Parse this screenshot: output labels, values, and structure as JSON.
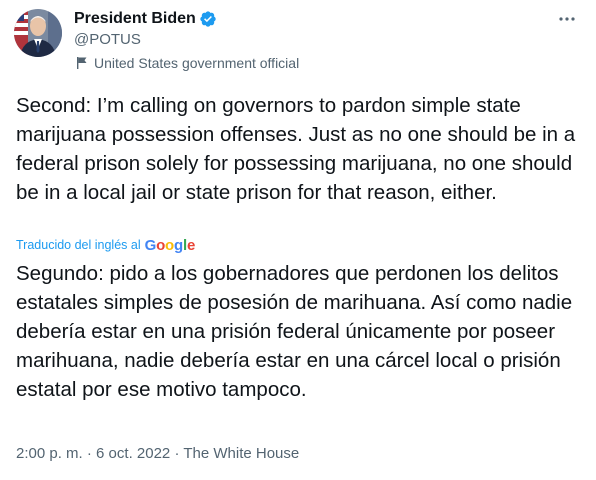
{
  "author": {
    "display_name": "President Biden",
    "handle": "@POTUS",
    "label": "United States government official"
  },
  "tweet": {
    "text": "Second: I’m calling on governors to pardon simple state marijuana possession offenses. Just as no one should be in a federal prison solely for possessing marijuana, no one should be in a local jail or state prison for that reason, either."
  },
  "translation": {
    "label": "Traducido del inglés al",
    "provider": "Google",
    "text": "Segundo: pido a los gobernadores que perdonen los delitos estatales simples de posesión de marihuana. Así como nadie debería estar en una prisión federal únicamente por poseer marihuana, nadie debería estar en una cárcel local o prisión estatal por ese motivo tampoco."
  },
  "meta": {
    "time": "2:00 p. m.",
    "separator": "·",
    "date": "6 oct. 2022",
    "source": "The White House"
  },
  "colors": {
    "verified": "#1d9bf0",
    "link": "#1d9bf0",
    "secondary_text": "#536471",
    "primary_text": "#0f1419"
  },
  "icons": {
    "verified": "verified-badge-icon",
    "label": "flag-icon",
    "more": "more-options-icon"
  }
}
